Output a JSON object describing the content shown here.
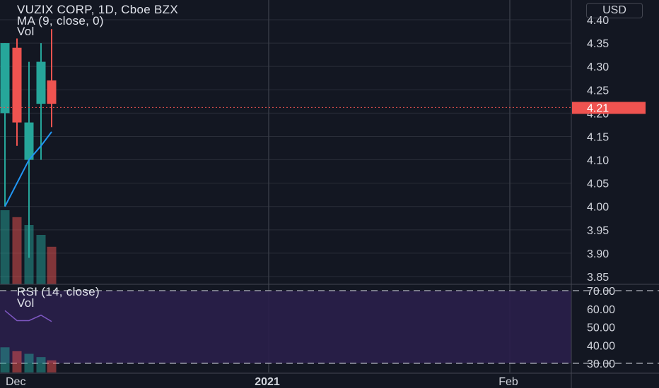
{
  "legend": {
    "symbol": "VUZIX CORP, 1D, Cboe BZX",
    "ma": "MA (9, close, 0)",
    "vol": "Vol",
    "rsi": "RSI (14, close)",
    "rsi_vol": "Vol"
  },
  "currency": "USD",
  "colors": {
    "background": "#131722",
    "up": "#26a69a",
    "down": "#ef5350",
    "grid": "#2a2e39",
    "rsi_band": "#2a1f4a",
    "rsi_line": "#7e57c2",
    "ma_line": "#2196f3",
    "axis_text": "#d1d4dc"
  },
  "chart_data": {
    "type": "candlestick",
    "title": "VUZIX CORP, 1D, Cboe BZX",
    "price_axis": {
      "ticks": [
        "4.40",
        "4.35",
        "4.30",
        "4.25",
        "4.20",
        "4.15",
        "4.10",
        "4.05",
        "4.00",
        "3.95",
        "3.90",
        "3.85"
      ],
      "range": [
        3.84,
        4.41
      ]
    },
    "last_price": {
      "label": "4.21",
      "value": 4.212
    },
    "time_axis": {
      "labels": [
        "Dec",
        "2021",
        "Feb"
      ]
    },
    "candles": [
      {
        "open": 4.2,
        "high": 4.35,
        "low": 4.0,
        "close": 4.35
      },
      {
        "open": 4.34,
        "high": 4.36,
        "low": 4.13,
        "close": 4.18
      },
      {
        "open": 4.1,
        "high": 4.31,
        "low": 3.89,
        "close": 4.18
      },
      {
        "open": 4.22,
        "high": 4.35,
        "low": 4.1,
        "close": 4.31
      },
      {
        "open": 4.27,
        "high": 4.38,
        "low": 4.17,
        "close": 4.22
      }
    ],
    "ma": {
      "name": "MA (9, close, 0)",
      "values": [
        4.0,
        4.05,
        4.1,
        4.13,
        4.16
      ]
    },
    "volume": [
      0.75,
      0.68,
      0.6,
      0.5,
      0.38
    ],
    "rsi": {
      "name": "RSI (14, close)",
      "ticks": [
        "70.00",
        "60.00",
        "50.00",
        "40.00",
        "30.00"
      ],
      "range": [
        27,
        73
      ],
      "bands": [
        70,
        30
      ],
      "values": [
        59,
        53.5,
        53.5,
        56.5,
        53
      ]
    },
    "rsi_volume": [
      0.85,
      0.72,
      0.63,
      0.52,
      0.41
    ]
  }
}
